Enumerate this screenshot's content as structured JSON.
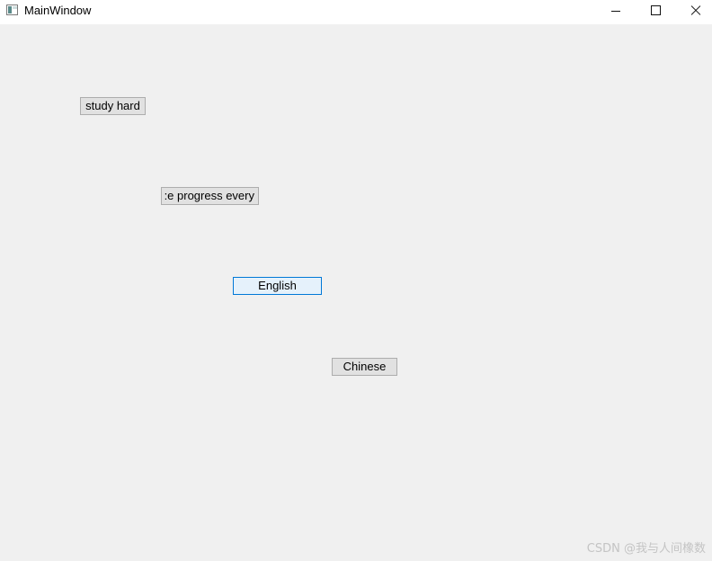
{
  "window": {
    "title": "MainWindow",
    "icon": "app-window-icon"
  },
  "controls": {
    "minimize": "minimize-icon",
    "maximize": "maximize-icon",
    "close": "close-icon"
  },
  "buttons": {
    "study_hard": "study hard",
    "progress": ":e progress every",
    "english": "English",
    "chinese": "Chinese"
  },
  "watermark": "CSDN @我与人间橡数",
  "colors": {
    "focus_border": "#0078d7",
    "focus_bg": "#e5f1fb",
    "button_bg": "#e1e1e1"
  }
}
